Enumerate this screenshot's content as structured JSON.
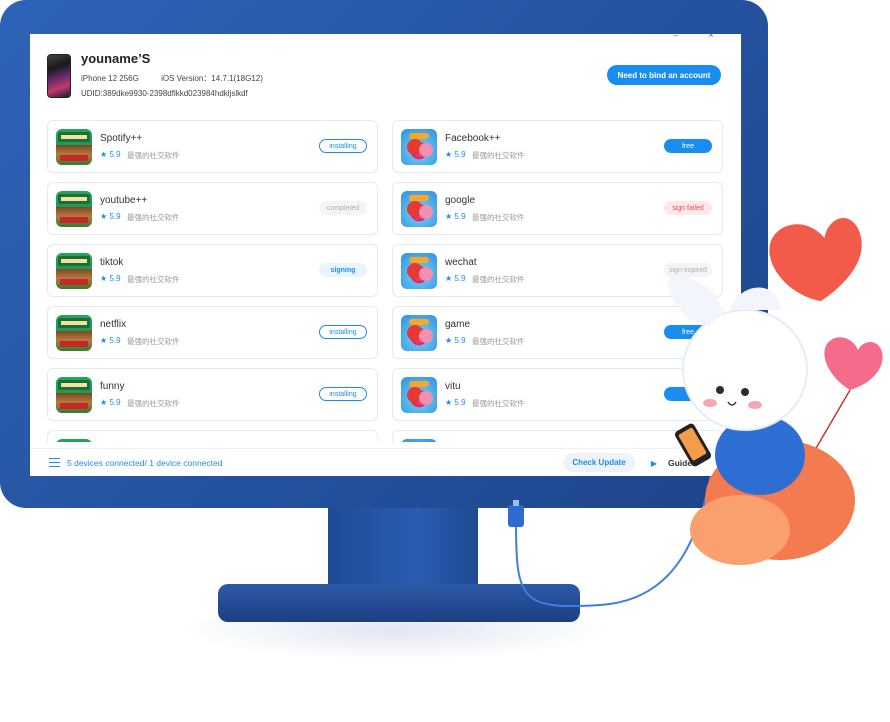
{
  "window": {
    "controls": "– ×"
  },
  "device": {
    "name": "youname’S",
    "model": "iPhone 12 256G",
    "ios_version": "iOS Version：14.7.1(18G12)",
    "udid": "UDID:389dke9930-2398dflkkd023984hdkljslkdf",
    "bind_button": "Need to bind an account"
  },
  "apps": [
    {
      "name": "Spotify++",
      "rating": "5.9",
      "tagline": "最强的社交软件",
      "status": "installing",
      "status_style": "outline",
      "icon": "green-game-icon"
    },
    {
      "name": "Facebook++",
      "rating": "5.9",
      "tagline": "最强的社交软件",
      "status": "free",
      "status_style": "solid",
      "icon": "angry-bird-icon"
    },
    {
      "name": "youtube++",
      "rating": "5.9",
      "tagline": "最强的社交软件",
      "status": "completed",
      "status_style": "grey",
      "icon": "green-game-icon"
    },
    {
      "name": "google",
      "rating": "5.9",
      "tagline": "最强的社交软件",
      "status": "sign failed",
      "status_style": "pink",
      "icon": "angry-bird-icon"
    },
    {
      "name": "tiktok",
      "rating": "5.9",
      "tagline": "最强的社交软件",
      "status": "signing",
      "status_style": "soft",
      "icon": "green-game-icon"
    },
    {
      "name": "wechat",
      "rating": "5.9",
      "tagline": "最强的社交软件",
      "status": "sign expired",
      "status_style": "grey",
      "icon": "angry-bird-icon"
    },
    {
      "name": "netflix",
      "rating": "5.9",
      "tagline": "最强的社交软件",
      "status": "installing",
      "status_style": "outline",
      "icon": "green-game-icon"
    },
    {
      "name": "game",
      "rating": "5.9",
      "tagline": "最强的社交软件",
      "status": "free",
      "status_style": "solid",
      "icon": "angry-bird-icon"
    },
    {
      "name": "funny",
      "rating": "5.9",
      "tagline": "最强的社交软件",
      "status": "installing",
      "status_style": "outline",
      "icon": "green-game-icon"
    },
    {
      "name": "vitu",
      "rating": "5.9",
      "tagline": "最强的社交软件",
      "status": "",
      "status_style": "solid",
      "icon": "angry-bird-icon"
    }
  ],
  "footer": {
    "connection_status": "5 devices connected/ 1 device connected",
    "check_update": "Check Update",
    "guide": "Guide"
  },
  "colors": {
    "accent": "#1a8df0",
    "bezel": "#2a5aaa",
    "error": "#e84a5f"
  }
}
